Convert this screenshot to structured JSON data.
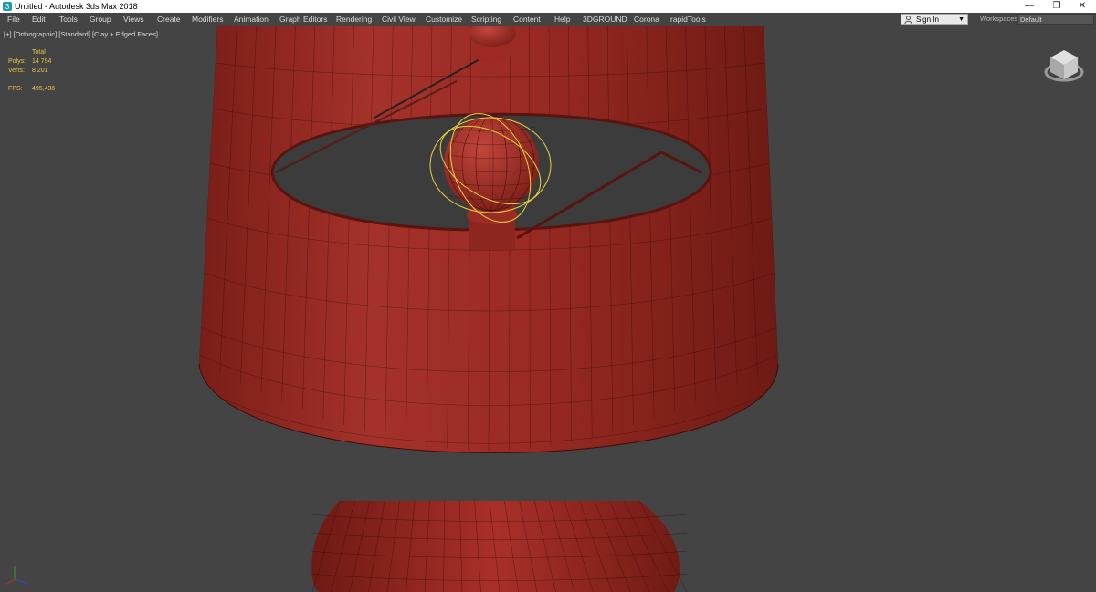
{
  "window": {
    "title": "Untitled - Autodesk 3ds Max 2018",
    "minimize_icon": "minimize-icon",
    "maximize_icon": "restore-icon",
    "close_icon": "close-icon"
  },
  "menu": {
    "items": [
      "File",
      "Edit",
      "Tools",
      "Group",
      "Views",
      "Create",
      "Modifiers",
      "Animation",
      "Graph Editors",
      "Rendering",
      "Civil View",
      "Customize",
      "Scripting",
      "Content",
      "Help",
      "3DGROUND",
      "Corona",
      "rapidTools"
    ],
    "signin": "Sign In",
    "workspaces_label": "Workspaces:",
    "workspace_value": "Default"
  },
  "viewport": {
    "label_plus": "[+]",
    "label_view": "[Orthographic]",
    "label_shading": "[Standard]",
    "label_mode": "[Clay + Edged Faces]",
    "stats": {
      "total_label": "Total",
      "polys_label": "Polys:",
      "polys_value": "14 794",
      "verts_label": "Verts:",
      "verts_value": "8 201",
      "fps_label": "FPS:",
      "fps_value": "495,436"
    }
  },
  "colors": {
    "viewport_bg": "#444444",
    "model_red": "#9c2a22",
    "selection_yellow": "#e8d23a",
    "stats_yellow": "#e5c84a"
  },
  "icons": [
    "app-icon",
    "person-icon",
    "dropdown-caret-icon",
    "viewcube-icon",
    "axis-gizmo-icon"
  ]
}
